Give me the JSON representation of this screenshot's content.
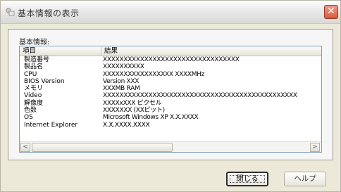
{
  "window": {
    "title": "基本情報の表示",
    "close_glyph": "✕"
  },
  "group": {
    "label": "基本情報:"
  },
  "list": {
    "columns": [
      "項目",
      "結果"
    ],
    "rows": [
      {
        "item": "製造番号",
        "value": "XXXXXXXXXXXXXXXXXXXXXXXXXXXXXXXXX"
      },
      {
        "item": "製品名",
        "value": "XXXXXXXXXX"
      },
      {
        "item": "CPU",
        "value": "XXXXXXXXXXXXXXXXX  XXXXMHz"
      },
      {
        "item": "BIOS Version",
        "value": "Version XXX"
      },
      {
        "item": "メモリ",
        "value": "XXXMB RAM"
      },
      {
        "item": "Video",
        "value": "XXXXXXXXXXXXXXXXXXXXXXXXXXXXXXXXXXXXXXXXXXXXXXX"
      },
      {
        "item": "解像度",
        "value": "XXXXxXXX ピクセル"
      },
      {
        "item": "色数",
        "value": "XXXXXXX (XXビット)"
      },
      {
        "item": "OS",
        "value": "Microsoft Windows XP  X.X.XXXX"
      },
      {
        "item": "Internet Explorer",
        "value": "X.X.XXXX.XXXX"
      }
    ],
    "scroll_left_glyph": "<",
    "scroll_right_glyph": ">"
  },
  "buttons": {
    "close_label": "閉じる",
    "help_label": "ヘルプ"
  },
  "colors": {
    "panel_background": "#ece9d8",
    "list_border": "#7f9db9",
    "close_button": "#d9593e"
  }
}
